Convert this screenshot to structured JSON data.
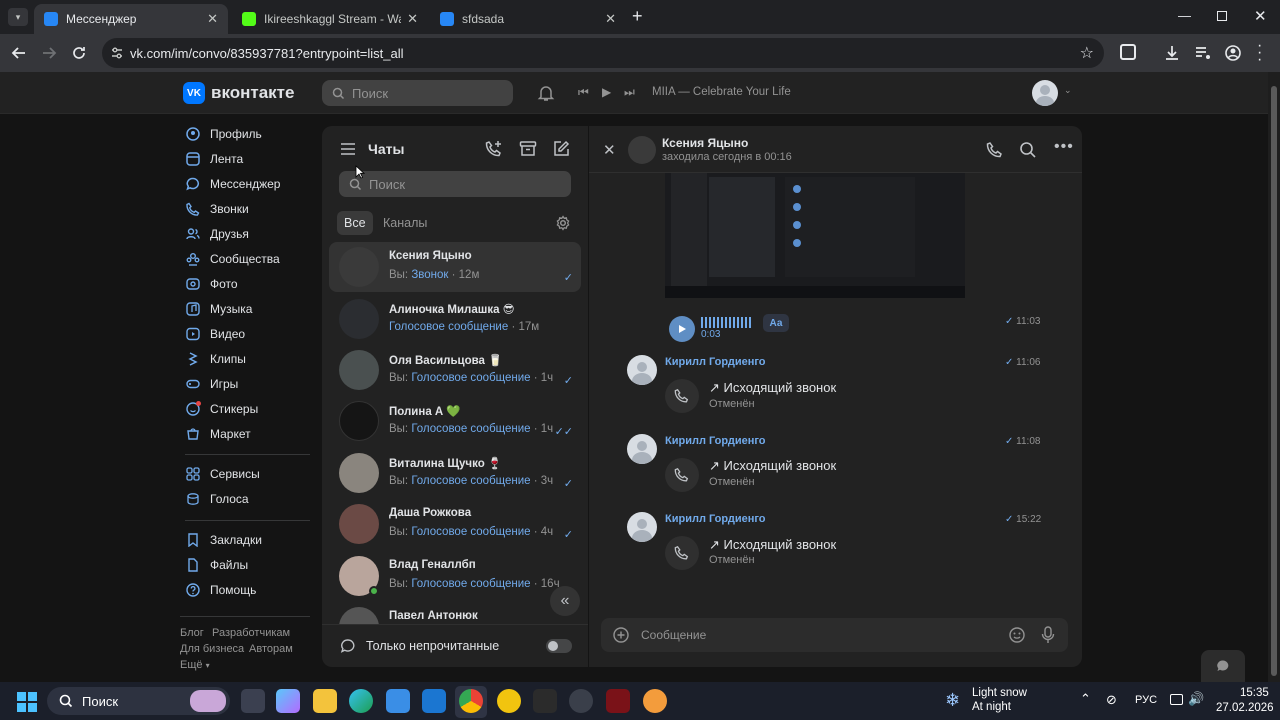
{
  "browser": {
    "tabs": [
      {
        "title": "Мессенджер",
        "favicon_color": "#2787f5"
      },
      {
        "title": "Ikireeshkaggl Stream - Watch Live on Kick",
        "favicon_color": "#53fc18"
      },
      {
        "title": "sfdsada",
        "favicon_color": "#2787f5"
      }
    ],
    "url": "vk.com/im/convo/835937781?entrypoint=list_all"
  },
  "header": {
    "logo": "вконтакте",
    "search_placeholder": "Поиск",
    "player_track": "MIIA — Celebrate Your Life"
  },
  "sidebar": {
    "items": [
      {
        "label": "Профиль",
        "icon": "user-icon"
      },
      {
        "label": "Лента",
        "icon": "feed-icon"
      },
      {
        "label": "Мессенджер",
        "icon": "message-icon"
      },
      {
        "label": "Звонки",
        "icon": "phone-icon"
      },
      {
        "label": "Друзья",
        "icon": "friends-icon"
      },
      {
        "label": "Сообщества",
        "icon": "communities-icon"
      },
      {
        "label": "Фото",
        "icon": "photo-icon"
      },
      {
        "label": "Музыка",
        "icon": "music-icon"
      },
      {
        "label": "Видео",
        "icon": "video-icon"
      },
      {
        "label": "Клипы",
        "icon": "clips-icon"
      },
      {
        "label": "Игры",
        "icon": "games-icon"
      },
      {
        "label": "Стикеры",
        "icon": "stickers-icon"
      },
      {
        "label": "Маркет",
        "icon": "market-icon"
      }
    ],
    "items2": [
      {
        "label": "Сервисы",
        "icon": "services-icon"
      },
      {
        "label": "Голоса",
        "icon": "votes-icon"
      }
    ],
    "items3": [
      {
        "label": "Закладки",
        "icon": "bookmark-icon"
      },
      {
        "label": "Файлы",
        "icon": "files-icon"
      },
      {
        "label": "Помощь",
        "icon": "help-icon"
      }
    ],
    "footer": {
      "blog": "Блог",
      "developers": "Разработчикам",
      "business": "Для бизнеса",
      "authors": "Авторам",
      "more": "Ещё"
    }
  },
  "chatlist": {
    "title": "Чаты",
    "search_placeholder": "Поиск",
    "tab_all": "Все",
    "tab_channels": "Каналы",
    "unread_only": "Только непрочитанные",
    "chats": [
      {
        "name": "Ксения Яцыно",
        "prefix": "Вы: ",
        "preview": "Звонок",
        "time": "· 12м",
        "status": "✓",
        "avatar": "#3a3a3a"
      },
      {
        "name": "Алиночка Милашка 😎",
        "prefix": "",
        "preview": "Голосовое сообщение",
        "time": "· 17м",
        "status": "",
        "avatar": "#2b2d31"
      },
      {
        "name": "Оля Васильцова 🥛",
        "prefix": "Вы: ",
        "preview": "Голосовое сообщение",
        "time": "· 1ч",
        "status": "✓",
        "avatar": "#4a5050"
      },
      {
        "name": "Полина А 💚",
        "prefix": "Вы: ",
        "preview": "Голосовое сообщение",
        "time": "· 1ч",
        "status": "✓✓",
        "avatar": "#151515"
      },
      {
        "name": "Виталина Щучко 🍷",
        "prefix": "Вы: ",
        "preview": "Голосовое сообщение",
        "time": "· 3ч",
        "status": "✓",
        "avatar": "#8a857e"
      },
      {
        "name": "Даша Рожкова",
        "prefix": "Вы: ",
        "preview": "Голосовое сообщение",
        "time": "· 4ч",
        "status": "✓",
        "avatar": "#6b4a45"
      },
      {
        "name": "Влад Геналлбп",
        "prefix": "Вы: ",
        "preview": "Голосовое сообщение",
        "time": "· 16ч",
        "status": "✓",
        "avatar": "#b9a59c"
      },
      {
        "name": "Павел Антонюк",
        "prefix": "",
        "preview": "",
        "time": "",
        "status": "",
        "avatar": "#555555"
      }
    ]
  },
  "conversation": {
    "name": "Ксения Яцыно",
    "status": "заходила сегодня в 00:16",
    "voice": {
      "duration": "0:03",
      "transcribe": "Аа",
      "time": "11:03"
    },
    "messages": [
      {
        "author": "Кирилл Гордиенго",
        "time": "11:06",
        "title": "↗ Исходящий звонок",
        "sub": "Отменён"
      },
      {
        "author": "Кирилл Гордиенго",
        "time": "11:08",
        "title": "↗ Исходящий звонок",
        "sub": "Отменён"
      },
      {
        "author": "Кирилл Гордиенго",
        "time": "15:22",
        "title": "↗ Исходящий звонок",
        "sub": "Отменён"
      }
    ],
    "input_placeholder": "Сообщение"
  },
  "taskbar": {
    "search": "Поиск",
    "weather_title": "Light snow",
    "weather_sub": "At night",
    "lang": "РУС",
    "time": "15:35",
    "date": "27.02.2026"
  },
  "colors": {
    "accent": "#71aaeb",
    "vk_blue": "#0077ff",
    "panel": "#222222"
  }
}
